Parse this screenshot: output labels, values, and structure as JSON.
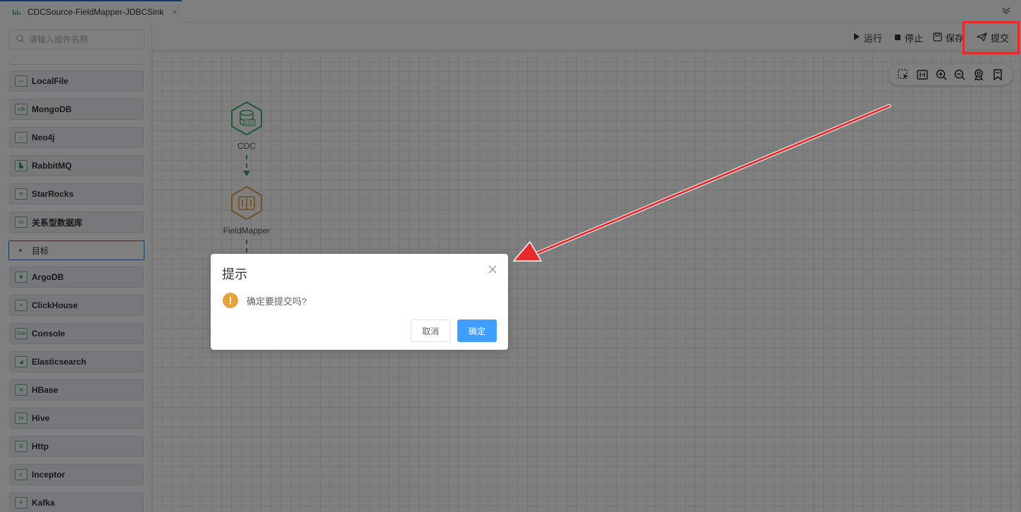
{
  "tab": {
    "title": "CDCSource-FieldMapper-JDBCSink",
    "icon": "flow-icon",
    "close": "×"
  },
  "sidebar": {
    "search_placeholder": "请输入组件名称",
    "source_items": [
      {
        "label": "LocalFile",
        "icon": "folder-icon",
        "glyph": "▭"
      },
      {
        "label": "MongoDB",
        "icon": "mongodb-icon",
        "glyph": "◖db"
      },
      {
        "label": "Neo4j",
        "icon": "graph-icon",
        "glyph": "⁘"
      },
      {
        "label": "RabbitMQ",
        "icon": "rabbitmq-icon",
        "glyph": "▙"
      },
      {
        "label": "StarRocks",
        "icon": "starrocks-icon",
        "glyph": "≋"
      },
      {
        "label": "关系型数据库",
        "icon": "database-icon",
        "glyph": "⛁"
      }
    ],
    "group_label": "目标",
    "target_items": [
      {
        "label": "ArgoDB",
        "icon": "argodb-icon",
        "glyph": "✺"
      },
      {
        "label": "ClickHouse",
        "icon": "clickhouse-icon",
        "glyph": "⚛"
      },
      {
        "label": "Console",
        "icon": "console-icon",
        "glyph": "Con"
      },
      {
        "label": "Elasticsearch",
        "icon": "elasticsearch-icon",
        "glyph": "◢"
      },
      {
        "label": "HBase",
        "icon": "hbase-icon",
        "glyph": "H"
      },
      {
        "label": "Hive",
        "icon": "hive-icon",
        "glyph": "Hi"
      },
      {
        "label": "Http",
        "icon": "http-icon",
        "glyph": "☰"
      },
      {
        "label": "Inceptor",
        "icon": "inceptor-icon",
        "glyph": "◐"
      },
      {
        "label": "Kafka",
        "icon": "kafka-icon",
        "glyph": "⚘"
      }
    ]
  },
  "toolbar": {
    "run": "运行",
    "stop": "停止",
    "save": "保存",
    "submit": "提交"
  },
  "graph_tools": [
    "select-icon",
    "fit-icon",
    "zoom-in-icon",
    "zoom-out-icon",
    "center-icon",
    "bookmark-icon"
  ],
  "nodes": [
    {
      "label": "CDC",
      "color": "#3fae6e",
      "icon_text": "CDC"
    },
    {
      "label": "FieldMapper",
      "color": "#e0a23a",
      "icon_text": "[]"
    }
  ],
  "dialog": {
    "title": "提示",
    "message": "确定要提交吗?",
    "cancel": "取消",
    "confirm": "确定",
    "close": "×"
  },
  "colors": {
    "primary": "#409eff",
    "warning": "#e6a23c",
    "annotation": "#e52b2b",
    "cdc": "#3fae6e",
    "mapper": "#e0a23a"
  }
}
